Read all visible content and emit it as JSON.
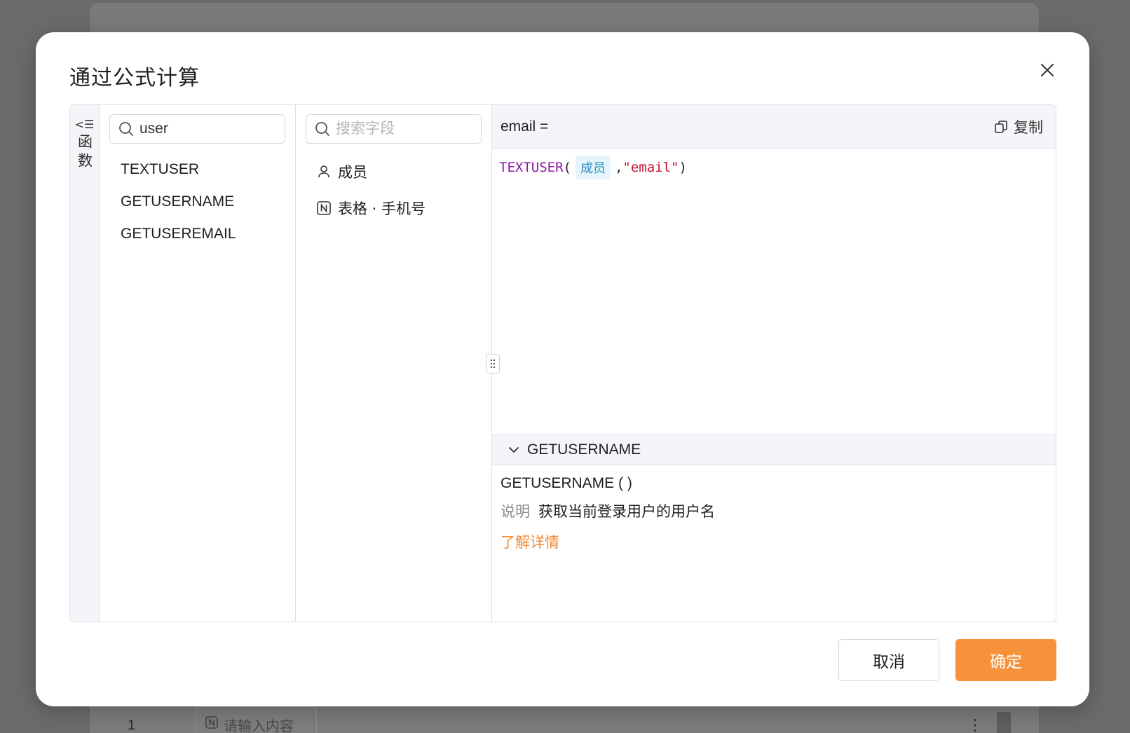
{
  "background": {
    "row_number": "1",
    "cell_placeholder": "请输入内容",
    "kebab": "⋮"
  },
  "dialog": {
    "title": "通过公式计算",
    "close_label": "✕"
  },
  "strip": {
    "icon": "<☰",
    "label": "函数"
  },
  "functions": {
    "search_value": "user",
    "items": [
      "TEXTUSER",
      "GETUSERNAME",
      "GETUSEREMAIL"
    ]
  },
  "fields": {
    "search_placeholder": "搜索字段",
    "items": [
      {
        "label": "成员",
        "icon": "person-icon"
      },
      {
        "label": "表格 · 手机号",
        "icon": "number-field-icon"
      }
    ]
  },
  "editor": {
    "target": "email =",
    "copy_label": "复制",
    "code": {
      "fn": "TEXTUSER",
      "open": "(",
      "field": "成员",
      "comma": ",",
      "string": "\"email\"",
      "close": ")"
    }
  },
  "fn_doc": {
    "name": "GETUSERNAME",
    "signature": "GETUSERNAME ( )",
    "desc_key": "说明",
    "desc_value": "获取当前登录用户的用户名",
    "learn_more": "了解详情"
  },
  "footer": {
    "cancel_label": "取消",
    "ok_label": "确定"
  },
  "colors": {
    "accent": "#f7923a",
    "link": "#f7872e",
    "function_token": "#8b1aa8",
    "string_token": "#c4122c",
    "field_token": "#2a8fc4"
  }
}
